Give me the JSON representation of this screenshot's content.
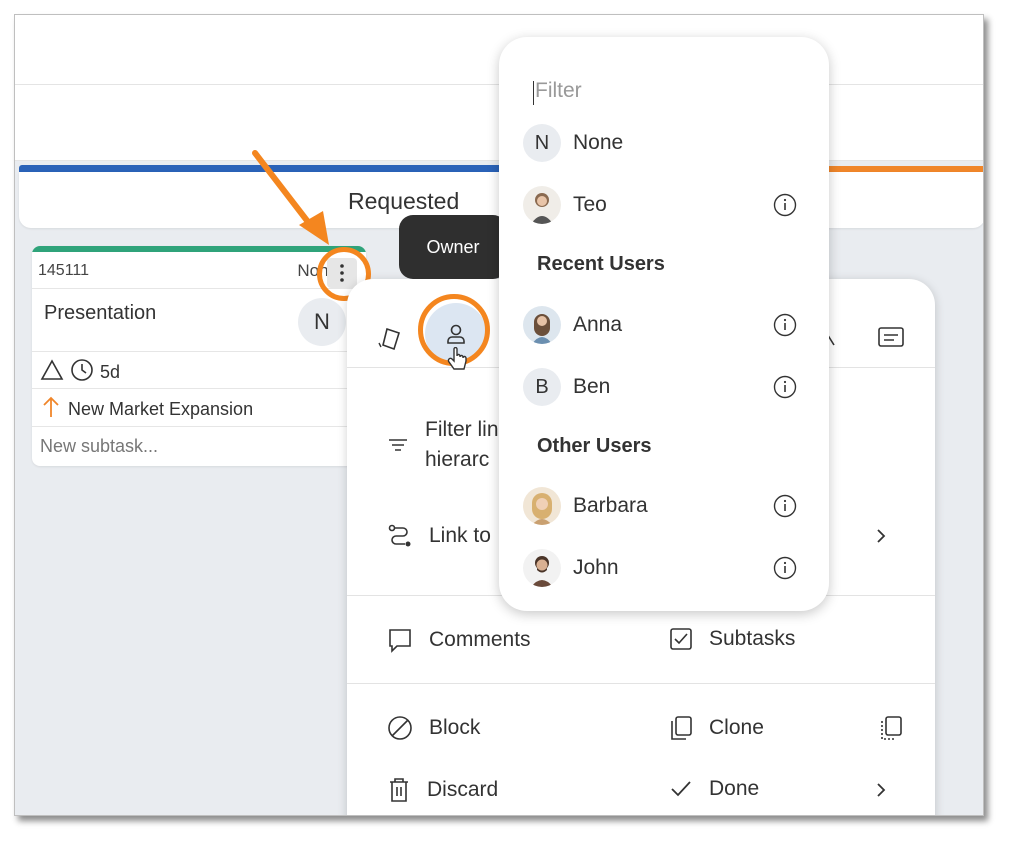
{
  "column": {
    "title": "Requested"
  },
  "card": {
    "id": "145111",
    "owner_label": "None",
    "title": "Presentation",
    "avatar_initial": "N",
    "duration": "5d",
    "parent": "New Market Expansion",
    "new_subtask_placeholder": "New subtask..."
  },
  "tooltip": {
    "text": "Owner"
  },
  "menu": {
    "filter_link": "Filter lin",
    "filter_link_line2": "hierarc",
    "link_to": "Link to",
    "comments": "Comments",
    "subtasks": "Subtasks",
    "block": "Block",
    "clone": "Clone",
    "discard": "Discard",
    "done": "Done"
  },
  "owner_dropdown": {
    "filter_placeholder": "Filter",
    "top_users": [
      {
        "initial": "N",
        "name": "None",
        "has_info": false
      },
      {
        "initial": "",
        "name": "Teo",
        "has_info": true,
        "avatar_color": "#8a6a50"
      }
    ],
    "recent_heading": "Recent Users",
    "recent_users": [
      {
        "initial": "",
        "name": "Anna",
        "has_info": true,
        "avatar_color": "#6b8fb0"
      },
      {
        "initial": "B",
        "name": "Ben",
        "has_info": true
      }
    ],
    "other_heading": "Other Users",
    "other_users": [
      {
        "initial": "",
        "name": "Barbara",
        "has_info": true,
        "avatar_color": "#c9a070"
      },
      {
        "initial": "",
        "name": "John",
        "has_info": true,
        "avatar_color": "#6a4a3a"
      }
    ]
  },
  "colors": {
    "accent_orange": "#f4861f",
    "blue_bar": "#2a62b8",
    "green_bar": "#2fa37a"
  }
}
